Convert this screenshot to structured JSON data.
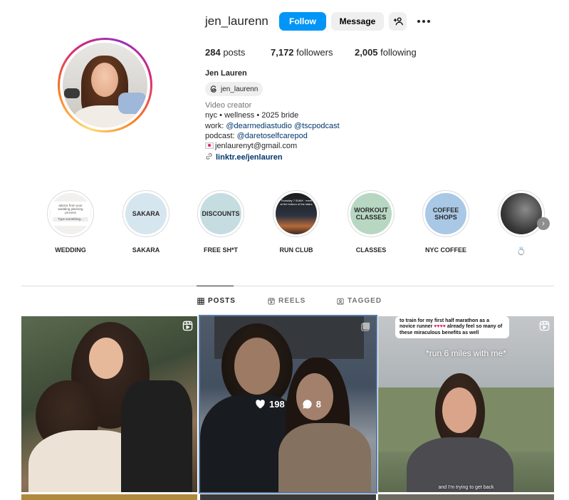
{
  "profile": {
    "username": "jen_laurenn",
    "full_name": "Jen Lauren",
    "threads_handle": "jen_laurenn",
    "category": "Video creator",
    "bio_line1": "nyc • wellness • 2025 bride",
    "bio_work_prefix": "work: ",
    "bio_work_link1": "@dearmediastudio",
    "bio_work_link2": "@tscpodcast",
    "bio_podcast_prefix": "podcast: ",
    "bio_podcast_link": "@daretoselfcarepod",
    "bio_email": "jenlaurenyt@gmail.com",
    "bio_link": "linktr.ee/jenlauren"
  },
  "actions": {
    "follow_label": "Follow",
    "message_label": "Message",
    "add_user_icon": "add-user-icon",
    "more_icon": "more-icon"
  },
  "stats": {
    "posts_count": "284",
    "posts_label": " posts",
    "followers_count": "7,172",
    "followers_label": " followers",
    "following_count": "2,005",
    "following_label": " following"
  },
  "highlights": [
    {
      "label": "WEDDING",
      "cover_text": "advice from your wedding planning process",
      "cover_input": "Type something..."
    },
    {
      "label": "SAKARA",
      "cover_text": "SAKARA",
      "cover_color": "#d6e6ef"
    },
    {
      "label": "FREE SH*T",
      "cover_text": "DISCOUNTS",
      "cover_color": "#c5dde1"
    },
    {
      "label": "RUN CLUB",
      "cover_text": "Thursday 7:30AM · meet at the bottom of the stairs"
    },
    {
      "label": "CLASSES",
      "cover_text": "WORKOUT CLASSES",
      "cover_color": "#b7d7c2"
    },
    {
      "label": "NYC COFFEE",
      "cover_text": "COFFEE SHOPS",
      "cover_color": "#a9c8e6"
    },
    {
      "label": "💍"
    }
  ],
  "tabs": [
    {
      "label": "POSTS",
      "icon": "grid-icon",
      "active": true
    },
    {
      "label": "REELS",
      "icon": "reels-icon",
      "active": false
    },
    {
      "label": "TAGGED",
      "icon": "tagged-icon",
      "active": false
    }
  ],
  "posts": [
    {
      "type": "reel",
      "icon": "reel-icon"
    },
    {
      "type": "carousel",
      "icon": "carousel-icon",
      "likes": "198",
      "comments": "8"
    },
    {
      "type": "reel",
      "icon": "reel-icon",
      "caption_box": "to train for my first half marathon as a novice runner",
      "caption_box_tail": "already feel so many of these miraculous benefits as well",
      "overlay_text": "*run 6 miles with me*",
      "subtitle": "and I'm trying to get back"
    }
  ],
  "colors": {
    "accent": "#0095f6",
    "link": "#00376b",
    "muted": "#737373",
    "button_gray": "#efefef"
  }
}
